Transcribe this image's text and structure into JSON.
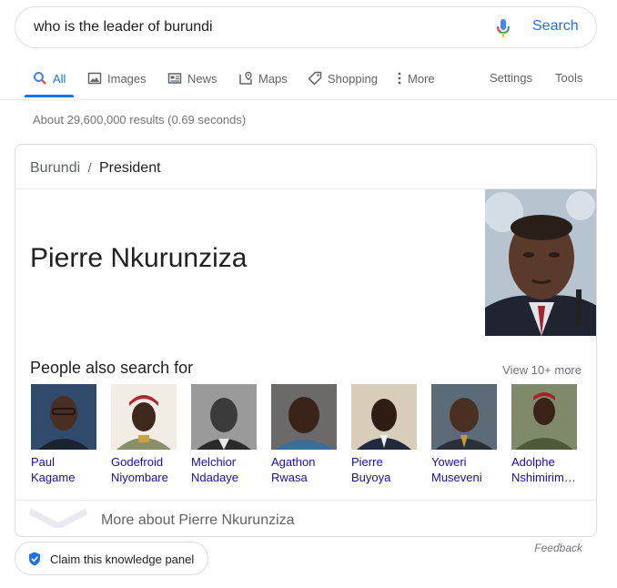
{
  "search": {
    "query": "who is the leader of burundi",
    "button_label": "Search"
  },
  "tabs": {
    "items": [
      {
        "label": "All",
        "icon": "search-icon"
      },
      {
        "label": "Images",
        "icon": "image-icon"
      },
      {
        "label": "News",
        "icon": "news-icon"
      },
      {
        "label": "Maps",
        "icon": "map-icon"
      },
      {
        "label": "Shopping",
        "icon": "tag-icon"
      },
      {
        "label": "More",
        "icon": "more-vert-icon"
      }
    ],
    "settings_label": "Settings",
    "tools_label": "Tools"
  },
  "stats": "About 29,600,000 results (0.69 seconds)",
  "knowledge_panel": {
    "breadcrumb_root": "Burundi",
    "breadcrumb_sep": "/",
    "breadcrumb_current": "President",
    "entity_name": "Pierre Nkurunziza",
    "people_title": "People also search for",
    "view_more": "View 10+ more",
    "people": [
      {
        "line1": "Paul",
        "line2": "Kagame"
      },
      {
        "line1": "Godefroid",
        "line2": "Niyombare"
      },
      {
        "line1": "Melchior",
        "line2": "Ndadaye"
      },
      {
        "line1": "Agathon",
        "line2": "Rwasa"
      },
      {
        "line1": "Pierre",
        "line2": "Buyoya"
      },
      {
        "line1": "Yoweri",
        "line2": "Museveni"
      },
      {
        "line1": "Adolphe",
        "line2": "Nshimirim…"
      }
    ],
    "more_about": "More about Pierre Nkurunziza"
  },
  "feedback": "Feedback",
  "claim": "Claim this knowledge panel",
  "colors": {
    "accent": "#1a73e8",
    "link": "#1a0dab",
    "muted": "#70757a",
    "border": "#dadce0"
  }
}
